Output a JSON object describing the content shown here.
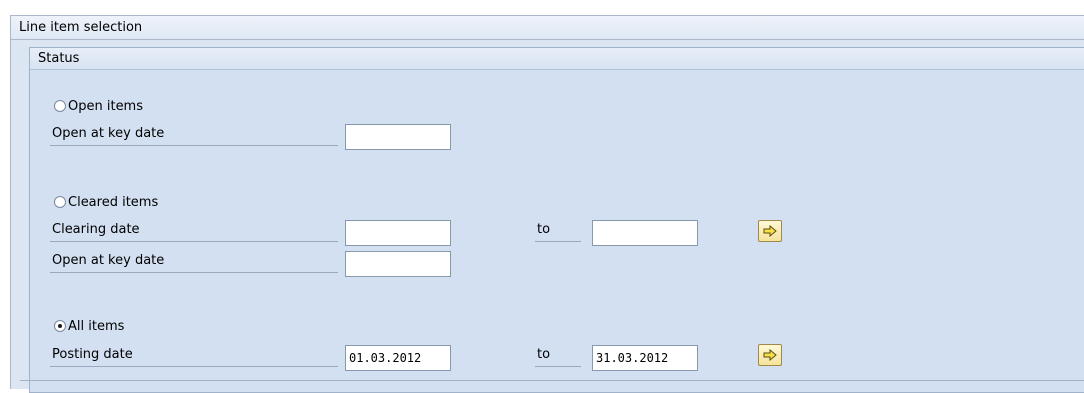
{
  "outer_title": "Line item selection",
  "status_title": "Status",
  "open_items": {
    "radio_label": "Open items",
    "selected": false,
    "key_date_label": "Open at key date",
    "key_date_value": ""
  },
  "cleared_items": {
    "radio_label": "Cleared items",
    "selected": false,
    "clearing_date_label": "Clearing date",
    "clearing_from": "",
    "to_label": "to",
    "clearing_to": "",
    "key_date_label": "Open at key date",
    "key_date_value": ""
  },
  "all_items": {
    "radio_label": "All items",
    "selected": true,
    "posting_date_label": "Posting date",
    "posting_from": "01.03.2012",
    "to_label": "to",
    "posting_to": "31.03.2012"
  },
  "icons": {
    "multiple_selection": "arrow-right-icon"
  },
  "colors": {
    "panel_bg": "#dce6f3",
    "group_bg": "#d3e0f1",
    "button_bg": "#f4e39a"
  }
}
